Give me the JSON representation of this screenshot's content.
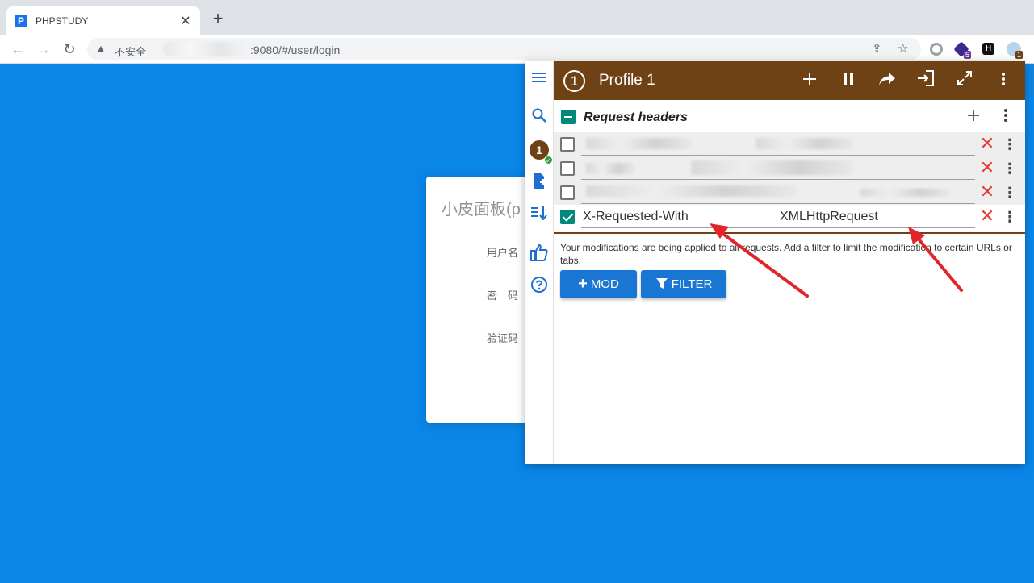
{
  "browser": {
    "tab_favicon": "P",
    "tab_title": "PHPSTUDY",
    "tab_close": "✕",
    "new_tab": "+",
    "insecure_label": "不安全",
    "url": ":9080/#/user/login",
    "extension_badges": [
      "5",
      "1"
    ],
    "extension_h_label": "H"
  },
  "page": {
    "title": "小皮面板(p",
    "username_label": "用户名",
    "password_label": "密　码",
    "captcha_label": "验证码"
  },
  "popup": {
    "sidebar": {
      "profile_number": "1"
    },
    "header": {
      "profile_number": "1",
      "title": "Profile 1"
    },
    "section": {
      "title": "Request headers"
    },
    "rows": [
      {
        "checked": false,
        "name": "",
        "value": ""
      },
      {
        "checked": false,
        "name": "",
        "value": ""
      },
      {
        "checked": false,
        "name": "",
        "value": ""
      },
      {
        "checked": true,
        "name": "X-Requested-With",
        "value": "XMLHttpRequest"
      }
    ],
    "info_text": "Your modifications are being applied to all requests. Add a filter to limit the modification to certain URLs or tabs.",
    "buttons": {
      "mod_label": "MOD",
      "filter_label": "FILTER"
    }
  },
  "colors": {
    "page_background": "#0a86e8",
    "header_brown": "#6e4215",
    "checkbox_teal": "#00897b",
    "button_blue": "#1976d2",
    "delete_red": "#e53935",
    "annotation_arrow": "#e0262b"
  }
}
